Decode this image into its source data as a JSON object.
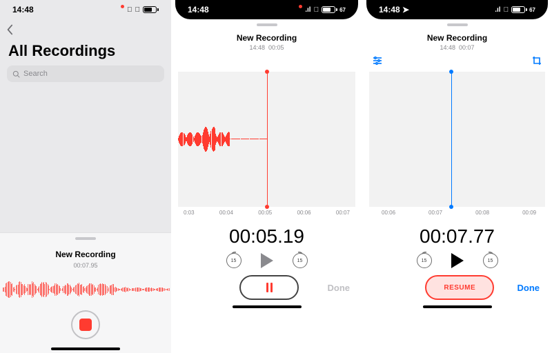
{
  "status": {
    "time": "14:48",
    "battery_pct": 67,
    "battery_label": "67"
  },
  "phone1": {
    "title": "All Recordings",
    "search_placeholder": "Search",
    "rec_title": "New Recording",
    "rec_time": "00:07.95"
  },
  "phone2": {
    "rec_title": "New Recording",
    "rec_sub_time": "14:48",
    "rec_sub_dur": "00:05",
    "ticks": [
      "0:03",
      "00:04",
      "00:05",
      "00:06",
      "00:07"
    ],
    "bigtime": "00:05.19",
    "skip_amount": "15",
    "done_label": "Done"
  },
  "phone3": {
    "rec_title": "New Recording",
    "rec_sub_time": "14:48",
    "rec_sub_dur": "00:07",
    "ticks": [
      "00:06",
      "00:07",
      "00:08",
      "00:09"
    ],
    "bigtime": "00:07.77",
    "skip_amount": "15",
    "resume_label": "RESUME",
    "done_label": "Done"
  },
  "colors": {
    "red": "#ff3b30",
    "blue": "#007aff"
  }
}
